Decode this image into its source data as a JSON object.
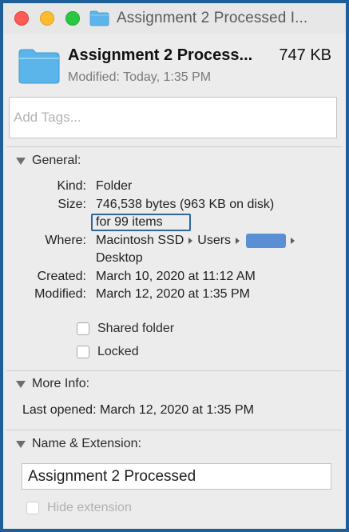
{
  "window": {
    "title": "Assignment 2 Processed I..."
  },
  "header": {
    "name": "Assignment 2 Process...",
    "size": "747 KB",
    "modified_label": "Modified:",
    "modified_value": "Today, 1:35 PM"
  },
  "tags": {
    "placeholder": "Add Tags...",
    "value": ""
  },
  "general": {
    "title": "General:",
    "kind_label": "Kind:",
    "kind_value": "Folder",
    "size_label": "Size:",
    "size_value": "746,538 bytes (963 KB on disk)",
    "size_items": "for 99 items",
    "where_label": "Where:",
    "where_path": [
      "Macintosh SSD",
      "Users"
    ],
    "where_last": "Desktop",
    "created_label": "Created:",
    "created_value": "March 10, 2020 at 11:12 AM",
    "modified_label": "Modified:",
    "modified_value": "March 12, 2020 at 1:35 PM",
    "shared_folder_label": "Shared folder",
    "shared_folder_checked": false,
    "locked_label": "Locked",
    "locked_checked": false
  },
  "more_info": {
    "title": "More Info:",
    "last_opened_label": "Last opened:",
    "last_opened_value": "March 12, 2020 at 1:35 PM"
  },
  "name_extension": {
    "title": "Name & Extension:",
    "name_value": "Assignment 2 Processed",
    "hide_extension_label": "Hide extension",
    "hide_extension_checked": false
  },
  "colors": {
    "close": "#fd5c56",
    "minimize": "#fdbc2e",
    "maximize": "#2ac840",
    "folder": "#5bb4ea",
    "frame": "#1f5f97",
    "redaction": "#5b8fd4"
  }
}
